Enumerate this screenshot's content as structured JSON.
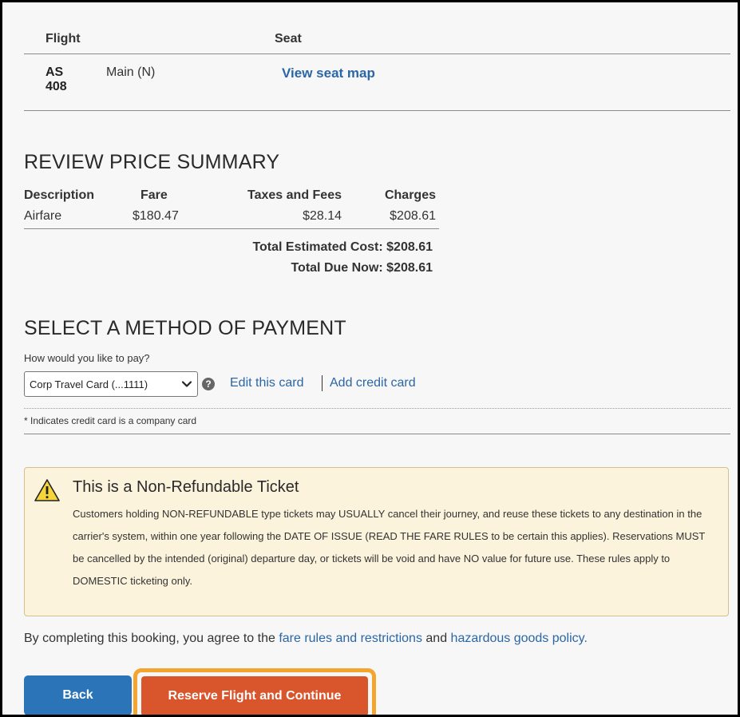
{
  "flight_table": {
    "header_flight": "Flight",
    "header_seat": "Seat",
    "rows": [
      {
        "flight_code": "AS 408",
        "cabin_class": "Main (N)",
        "seat_link": "View seat map"
      }
    ]
  },
  "price_summary": {
    "heading": "REVIEW PRICE SUMMARY",
    "columns": [
      "Description",
      "Fare",
      "Taxes and Fees",
      "Charges"
    ],
    "rows": [
      {
        "description": "Airfare",
        "fare": "$180.47",
        "taxes_fees": "$28.14",
        "charges": "$208.61"
      }
    ],
    "total_estimated_cost": "Total Estimated Cost: $208.61",
    "total_due_now": "Total Due Now: $208.61"
  },
  "payment": {
    "heading": "SELECT A METHOD OF PAYMENT",
    "question": "How would you like to pay?",
    "selected_card": "Corp Travel Card (...1111)",
    "edit_card_link": "Edit this card",
    "add_card_link": "Add credit card",
    "company_card_note": "* Indicates credit card is a company card"
  },
  "warning": {
    "title": "This is a Non-Refundable Ticket",
    "body": "Customers holding NON-REFUNDABLE type tickets may USUALLY cancel their journey, and reuse these tickets to any destination in the carrier's system, within one year following the DATE OF ISSUE (READ THE FARE RULES to be certain this applies). Reservations MUST be cancelled by the intended (original) departure day, or tickets will be void and have NO value for future use. These rules apply to DOMESTIC ticketing only."
  },
  "agreement": {
    "prefix": "By completing this booking, you agree to the ",
    "fare_rules_link": "fare rules and restrictions",
    "middle": " and ",
    "hazardous_link": "hazardous goods policy."
  },
  "actions": {
    "back_label": "Back",
    "reserve_label": "Reserve Flight and Continue"
  },
  "colors": {
    "link": "#2b66a6",
    "back_button": "#2b74b8",
    "reserve_button": "#d9552b",
    "highlight_outline": "#f3a530",
    "warning_background": "#fcf3dc"
  }
}
